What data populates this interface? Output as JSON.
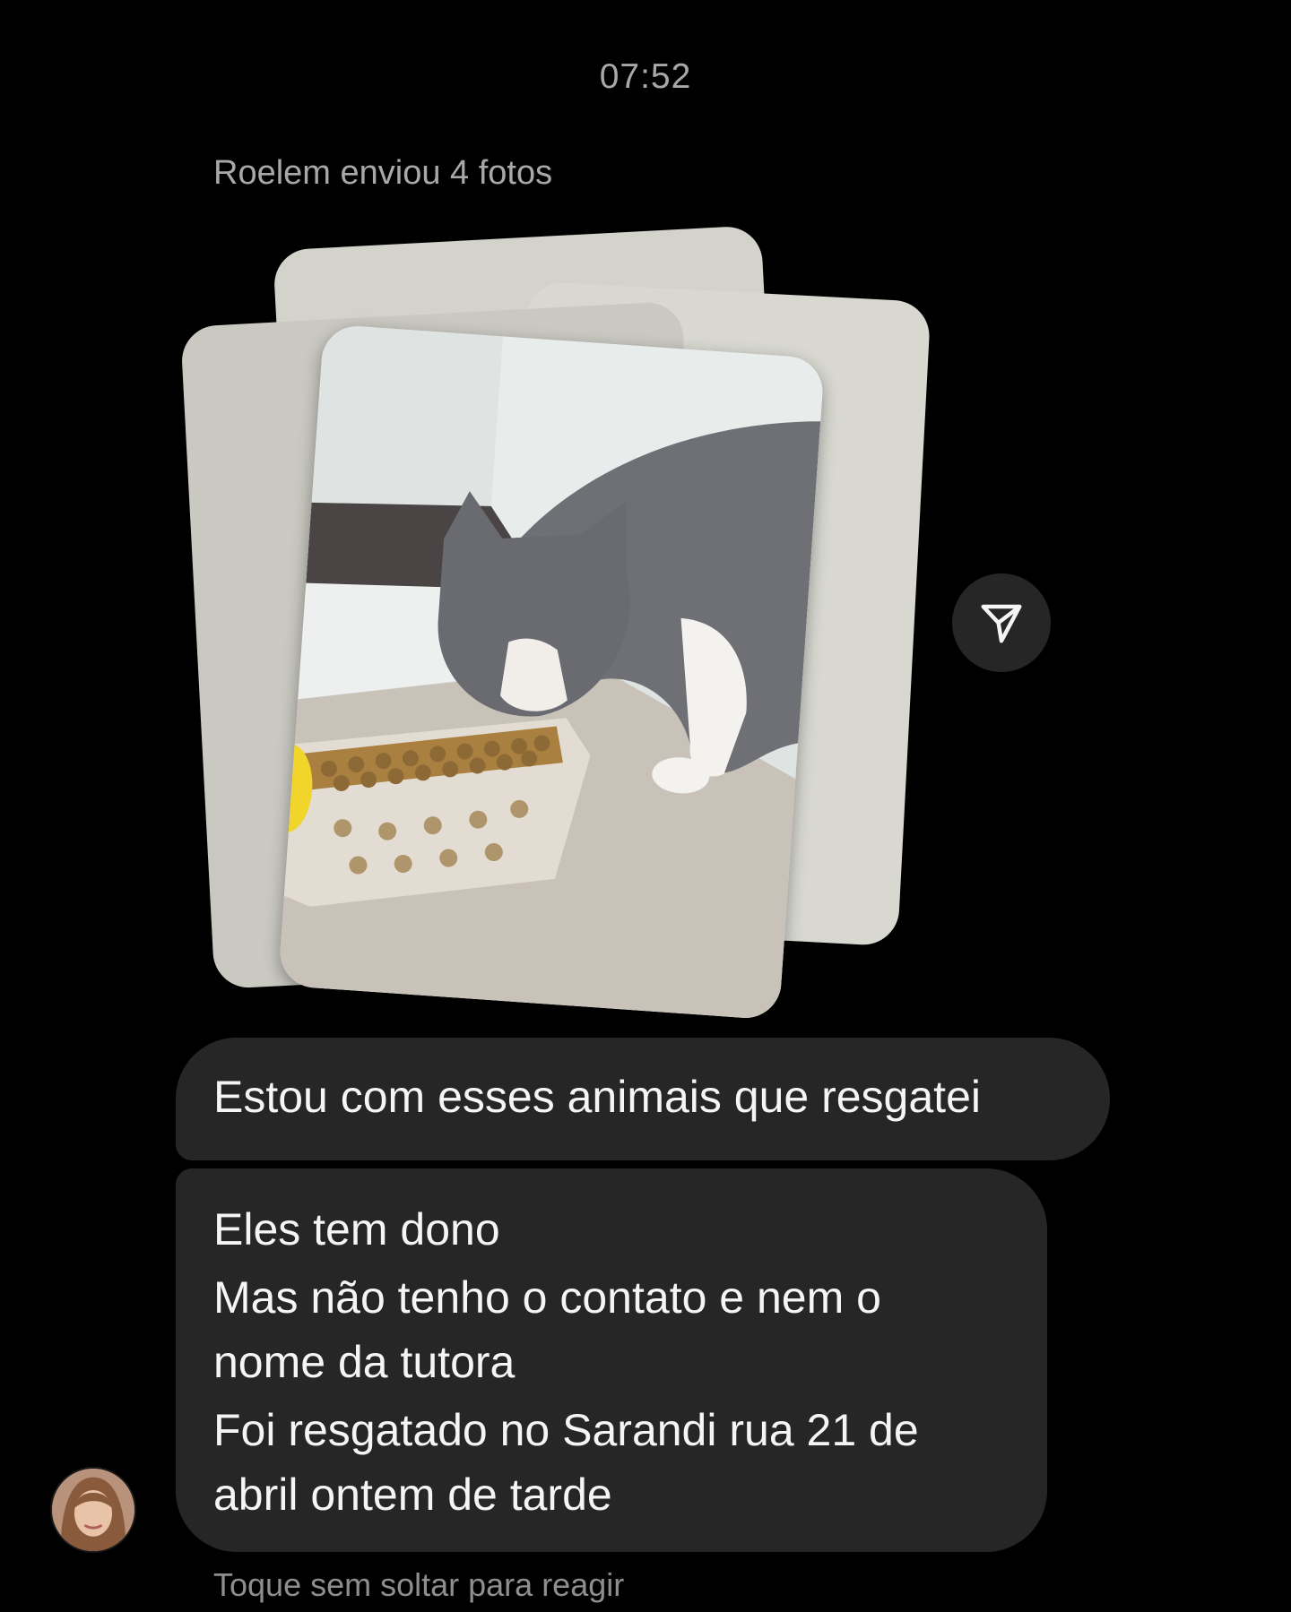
{
  "thread": {
    "timestamp": "07:52",
    "sent_note": "Roelem enviou 4 fotos",
    "photo_count": 4,
    "share_icon": "paper-plane-icon",
    "messages": [
      {
        "lines": [
          "Estou com esses animais que resgatei"
        ]
      },
      {
        "lines": [
          "Eles tem dono",
          "Mas não tenho o contato e nem o",
          "nome da tutora",
          "Foi resgatado no Sarandi rua 21 de",
          "abril ontem de tarde"
        ]
      }
    ],
    "hint": "Toque sem soltar para reagir"
  },
  "colors": {
    "background": "#000000",
    "bubble": "#262626",
    "text": "#f5f5f5",
    "muted": "#a8a8a8"
  }
}
